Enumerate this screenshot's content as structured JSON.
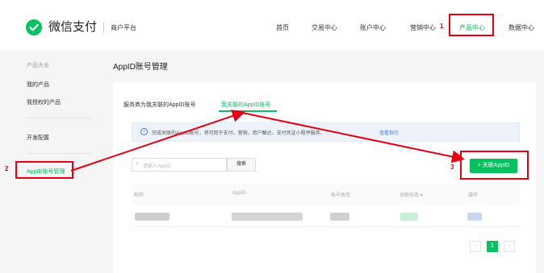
{
  "header": {
    "logo_text": "微信支付",
    "platform": "商户平台",
    "nav": [
      "首页",
      "交易中心",
      "账户中心",
      "营销中心",
      "产品中心",
      "数据中心"
    ],
    "active_nav_index": 4
  },
  "sidebar": {
    "section_title": "产品大全",
    "items": [
      "我的产品",
      "我授权的产品",
      "开发配置",
      "AppID账号管理"
    ]
  },
  "main": {
    "title": "AppID账号管理",
    "tabs": [
      "服务商为我关联的AppID账号",
      "我关联的AppID账号"
    ],
    "active_tab_index": 1,
    "notice": {
      "text": "完成关联的AppID账号，将可用于支付，营销，用户触达，支付凭证小程序服务。",
      "link": "查看指引"
    },
    "search": {
      "placeholder": "请输入AppID",
      "button": "搜索"
    },
    "add_button": "+ 关联AppID",
    "table": {
      "headers": [
        "昵称",
        "AppID",
        "账号类型",
        "关联状态 ▾",
        "操作"
      ]
    },
    "pagination": {
      "current": "1",
      "prev": "‹",
      "next": "›"
    }
  },
  "annotations": [
    "1",
    "2",
    "3"
  ],
  "colors": {
    "brand_green": "#07c160",
    "annotation_red": "#e60012",
    "link_blue": "#3b7ddd"
  }
}
